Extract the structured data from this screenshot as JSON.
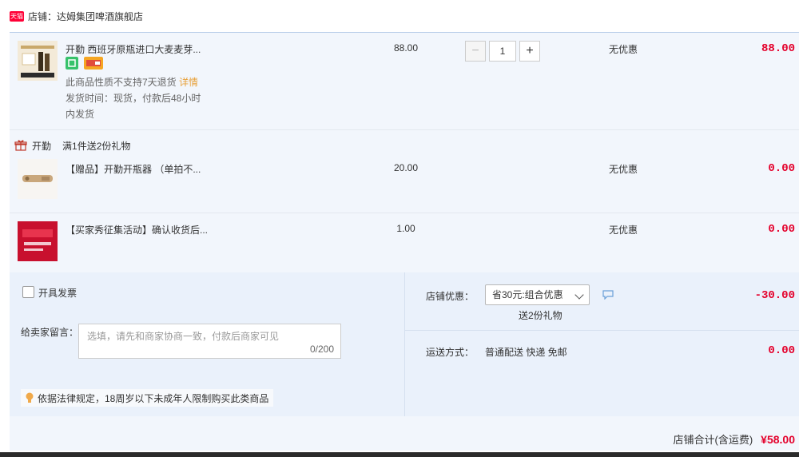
{
  "shop": {
    "badge": "天猫",
    "label": "店铺：达姆集团啤酒旗舰店"
  },
  "main_item": {
    "title": "开勤 西班牙原瓶进口大麦麦芽...",
    "price": "88.00",
    "quantity": "1",
    "discount": "无优惠",
    "subtotal": "88.00",
    "note_prefix": "此商品性质不支持7天退货",
    "note_link": "详情",
    "ship_line1": "发货时间：现货，付款后48小时",
    "ship_line2": "内发货",
    "qty_minus": "−",
    "qty_plus": "+"
  },
  "gift_header": {
    "brand": "开勤",
    "text": "满1件送2份礼物"
  },
  "gift_items": [
    {
      "title": "【赠品】开勤开瓶器 （单拍不...",
      "price": "20.00",
      "discount": "无优惠",
      "subtotal": "0.00"
    },
    {
      "title": "【买家秀征集活动】确认收货后...",
      "price": "1.00",
      "discount": "无优惠",
      "subtotal": "0.00"
    }
  ],
  "invoice": {
    "label": "开具发票"
  },
  "memo": {
    "label": "给卖家留言：",
    "placeholder": "选填，请先和商家协商一致，付款后商家可见",
    "count": "0/200"
  },
  "legal": {
    "text": "依据法律规定，18周岁以下未成年人限制购买此类商品"
  },
  "shop_discount": {
    "label": "店铺优惠：",
    "selected": "省30元:组合优惠",
    "sub": "送2份礼物",
    "amount": "-30.00"
  },
  "shipping": {
    "label": "运送方式：",
    "method": "普通配送 快递 免邮",
    "amount": "0.00"
  },
  "total": {
    "label": "店铺合计(含运费)",
    "amount": "¥58.00"
  },
  "colors": {
    "accent_red": "#e4002b",
    "tmall_red": "#ff0036",
    "panel_bg": "#f2f6fc",
    "orange_text": "#e8a13a"
  }
}
